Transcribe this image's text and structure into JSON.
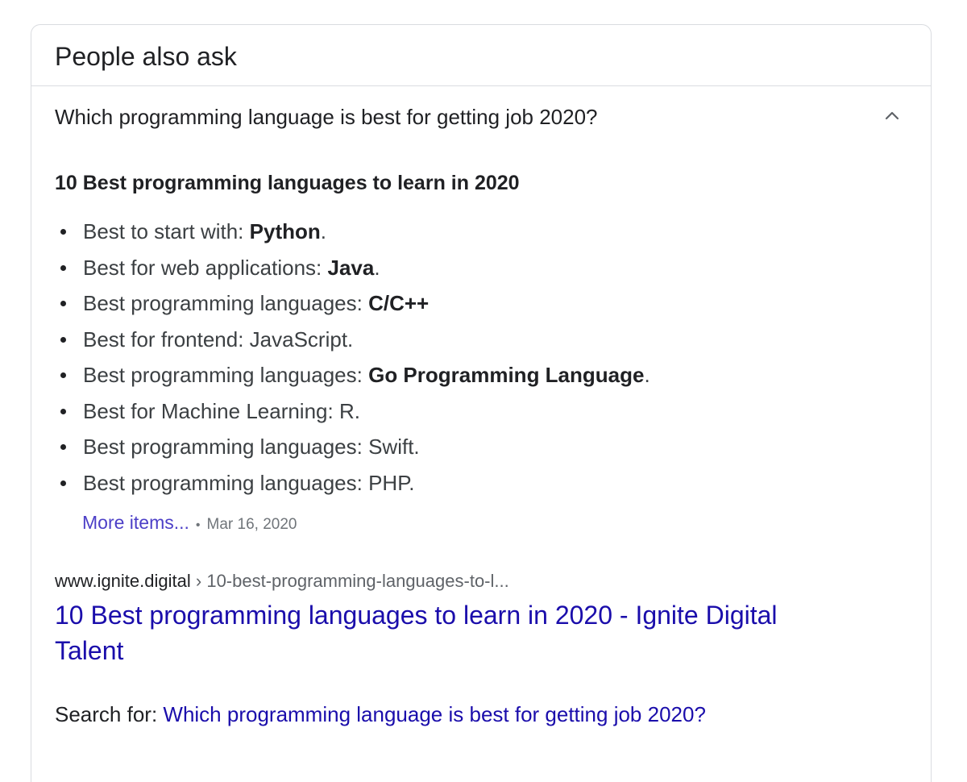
{
  "panel": {
    "title": "People also ask"
  },
  "question": {
    "text": "Which programming language is best for getting job 2020?",
    "expanded_icon": "chevron-up-icon"
  },
  "answer": {
    "heading": "10 Best programming languages to learn in 2020",
    "items": [
      {
        "prefix": "Best to start with: ",
        "bold": "Python",
        "suffix": "."
      },
      {
        "prefix": "Best for web applications: ",
        "bold": "Java",
        "suffix": "."
      },
      {
        "prefix": "Best programming languages: ",
        "bold": "C/C++",
        "suffix": ""
      },
      {
        "prefix": "Best for frontend: JavaScript.",
        "bold": "",
        "suffix": ""
      },
      {
        "prefix": "Best programming languages: ",
        "bold": "Go Programming Language",
        "suffix": "."
      },
      {
        "prefix": "Best for Machine Learning: R.",
        "bold": "",
        "suffix": ""
      },
      {
        "prefix": "Best programming languages: Swift.",
        "bold": "",
        "suffix": ""
      },
      {
        "prefix": "Best programming languages: PHP.",
        "bold": "",
        "suffix": ""
      }
    ],
    "more_label": "More items...",
    "separator": "•",
    "date": "Mar 16, 2020"
  },
  "source": {
    "domain": "www.ignite.digital",
    "breadcrumb_sep": "›",
    "path": "10-best-programming-languages-to-l...",
    "title": "10 Best programming languages to learn in 2020 - Ignite Digital Talent"
  },
  "search_for": {
    "label": "Search for: ",
    "query": "Which programming language is best for getting job 2020?"
  }
}
